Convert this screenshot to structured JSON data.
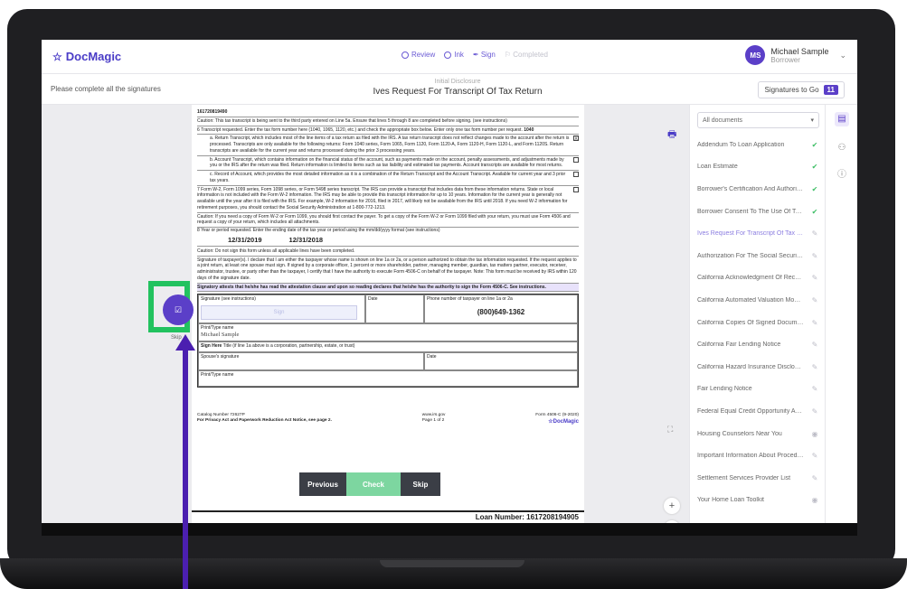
{
  "app": {
    "logo": "DocMagic"
  },
  "steps": [
    {
      "label": "Review"
    },
    {
      "label": "Ink"
    },
    {
      "label": "Sign"
    },
    {
      "label": "Completed"
    }
  ],
  "user": {
    "initials": "MS",
    "name": "Michael Sample",
    "role": "Borrower"
  },
  "subbar": {
    "instruction": "Please complete all the signatures",
    "doc_category": "Initial Disclosure",
    "doc_title": "Ives Request For Transcript Of Tax Return",
    "signatures_label": "Signatures to Go",
    "signatures_count": "11"
  },
  "document": {
    "ssn_fragment": "161720819490",
    "caution1": "Caution: This tax transcript is being sent to the third party entered on Line 5a. Ensure that lines 5 through 8 are completed before signing. (see instructions)",
    "line6": "6 Transcript requested. Enter the tax form number here (1040, 1065, 1120, etc.) and check the appropriate box below. Enter only one tax form number per request.",
    "form_number": "1040",
    "line6a": "a. Return Transcript, which includes most of the line items of a tax return as filed with the IRS. A tax return transcript does not reflect changes made to the account after the return is processed. Transcripts are only available for the following returns: Form 1040 series, Form 1065, Form 1120, Form 1120-A, Form 1120-H, Form 1120-L, and Form 1120S. Return transcripts are available for the current year and returns processed during the prior 3 processing years.",
    "line6a_mark": "X",
    "line6b": "b. Account Transcript, which contains information on the financial status of the account, such as payments made on the account, penalty assessments, and adjustments made by you or the IRS after the return was filed. Return information is limited to items such as tax liability and estimated tax payments. Account transcripts are available for most returns.",
    "line6c": "c. Record of Account, which provides the most detailed information as it is a combination of the Return Transcript and the Account Transcript. Available for current year and 3 prior tax years.",
    "line7": "7 Form W-2, Form 1099 series, Form 1098 series, or Form 5498 series transcript. The IRS can provide a transcript that includes data from these information returns. State or local information is not included with the Form W-2 information. The IRS may be able to provide this transcript information for up to 10 years. Information for the current year is generally not available until the year after it is filed with the IRS. For example, W-2 information for 2016, filed in 2017, will likely not be available from the IRS until 2018. If you need W-2 information for retirement purposes, you should contact the Social Security Administration at 1-800-772-1213.",
    "caution2": "Caution: If you need a copy of Form W-2 or Form 1099, you should first contact the payer. To get a copy of the Form W-2 or Form 1099 filed with your return, you must use Form 4506 and request a copy of your return, which includes all attachments.",
    "line8": "8 Year or period requested. Enter the ending date of the tax year or period using the mm/dd/yyyy format (see instructions)",
    "date1": "12/31/2019",
    "date2": "12/31/2018",
    "caution3": "Caution: Do not sign this form unless all applicable lines have been completed.",
    "signature_text": "Signature of taxpayer(s). I declare that I am either the taxpayer whose name is shown on line 1a or 2a, or a person authorized to obtain the tax information requested. If the request applies to a joint return, at least one spouse must sign. If signed by a corporate officer, 1 percent or more shareholder, partner, managing member, guardian, tax matters partner, executor, receiver, administrator, trustee, or party other than the taxpayer, I certify that I have the authority to execute Form 4506-C on behalf of the taxpayer. Note: This form must be received by IRS within 120 days of the signature date.",
    "attest": "Signatory attests that he/she has read the attestation clause and upon so reading declares that he/she has the authority to sign the Form 4506-C. See instructions.",
    "col_signature": "Signature (see instructions)",
    "col_date": "Date",
    "col_phone": "Phone number of taxpayer on line 1a or 2a",
    "sign_placeholder": "Sign",
    "phone": "(800)649-1362",
    "print_name_label": "Print/Type name",
    "printed_name": "Michael Sample",
    "title_label": "Title (if line 1a above is a corporation, partnership, estate, or trust)",
    "sign_here": "Sign Here",
    "spouse_sig": "Spouse's signature",
    "spouse_date": "Date",
    "print_name_label2": "Print/Type name",
    "catalog": "Catalog Number 72627P",
    "privacy": "For Privacy Act and Paperwork Reduction Act Notice, see page 2.",
    "irs_url": "www.irs.gov",
    "page": "Page 1 of 2",
    "form_id": "Form 4506-C (9-2020)",
    "footer_logo": "DocMagic",
    "loan_number": "Loan Number: 1617208194905"
  },
  "buttons": {
    "previous": "Previous",
    "check": "Check",
    "skip": "Skip",
    "skip_small": "Skip"
  },
  "sidebar": {
    "filter": "All documents",
    "items": [
      {
        "label": "Addendum To Loan Application",
        "status": "done"
      },
      {
        "label": "Loan Estimate",
        "status": "done"
      },
      {
        "label": "Borrower's Certification And Authoriza...",
        "status": "done"
      },
      {
        "label": "Borrower Consent To The Use Of Tax R...",
        "status": "done"
      },
      {
        "label": "Ives Request For Transcript Of Tax Ret...",
        "status": "pen"
      },
      {
        "label": "Authorization For The Social Security A...",
        "status": "pen"
      },
      {
        "label": "California Acknowledgment Of Receipt ...",
        "status": "pen"
      },
      {
        "label": "California Automated Valuation Model ...",
        "status": "pen"
      },
      {
        "label": "California Copies Of Signed Documents",
        "status": "pen"
      },
      {
        "label": "California Fair Lending Notice",
        "status": "pen"
      },
      {
        "label": "California Hazard Insurance Disclosure",
        "status": "pen"
      },
      {
        "label": "Fair Lending Notice",
        "status": "pen"
      },
      {
        "label": "Federal Equal Credit Opportunity Act N...",
        "status": "pen"
      },
      {
        "label": "Housing Counselors Near You",
        "status": "eye"
      },
      {
        "label": "Important Information About Procedur...",
        "status": "pen"
      },
      {
        "label": "Settlement Services Provider List",
        "status": "pen"
      },
      {
        "label": "Your Home Loan Toolkit",
        "status": "eye"
      }
    ]
  },
  "colors": {
    "brand": "#5b3fc8",
    "success": "#3fbf67",
    "highlight": "#22c25f",
    "check_button": "#7dd6a0"
  }
}
